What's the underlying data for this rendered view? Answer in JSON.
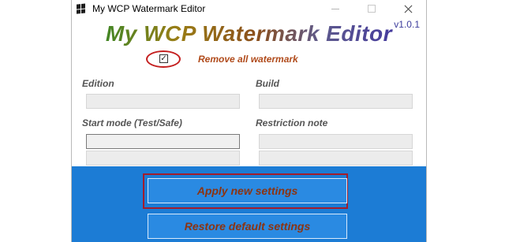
{
  "window": {
    "title": "My WCP Watermark Editor"
  },
  "header": {
    "app_title": "My WCP Watermark Editor",
    "version": "v1.0.1"
  },
  "options": {
    "remove_all_watermark": {
      "label": "Remove all watermark",
      "checked": true,
      "check_glyph": "☑"
    }
  },
  "fields": {
    "edition": {
      "label": "Edition",
      "value": ""
    },
    "build": {
      "label": "Build",
      "value": ""
    },
    "start_mode": {
      "label": "Start mode (Test/Safe)",
      "value_1": "",
      "value_2": ""
    },
    "restriction_note": {
      "label": "Restriction note",
      "value_1": "",
      "value_2": ""
    }
  },
  "buttons": {
    "apply_label": "Apply new settings",
    "restore_label": "Restore default settings"
  },
  "colors": {
    "bottom_band": "#1c7cd5",
    "button_text": "#8b3412",
    "annotation_red": "#c41f1f"
  }
}
